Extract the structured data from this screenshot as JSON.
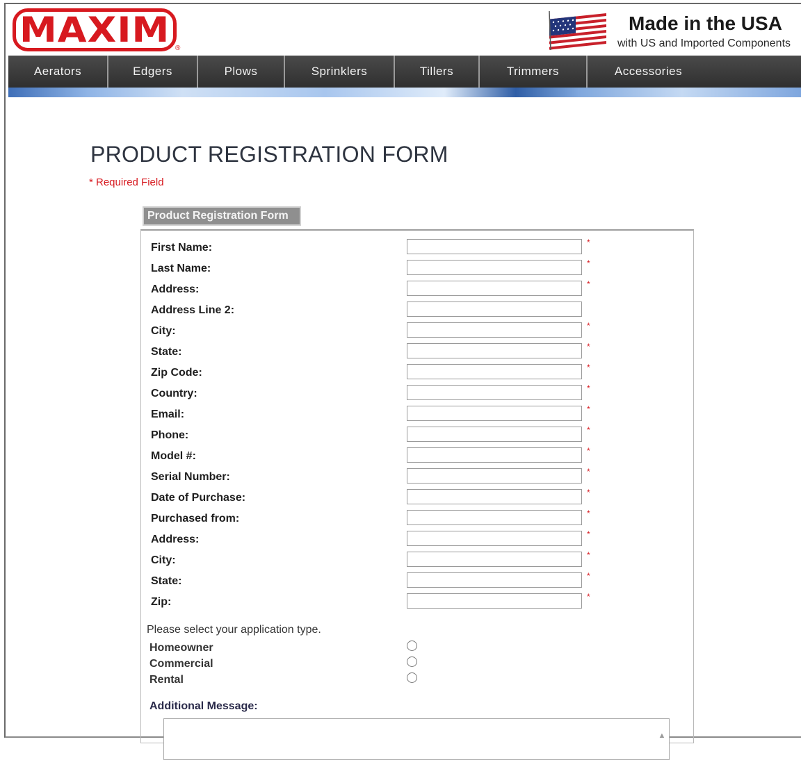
{
  "header": {
    "logo_text": "MAXIM",
    "logo_mark": "®",
    "flag_icon": "us-flag-icon",
    "made_title": "Made in the USA",
    "made_subtitle": "with US and Imported Components"
  },
  "nav": {
    "items": [
      {
        "label": "Aerators"
      },
      {
        "label": "Edgers"
      },
      {
        "label": "Plows"
      },
      {
        "label": "Sprinklers"
      },
      {
        "label": "Tillers"
      },
      {
        "label": "Trimmers"
      },
      {
        "label": "Accessories"
      }
    ]
  },
  "page": {
    "title": "PRODUCT REGISTRATION FORM",
    "required_note": "* Required Field"
  },
  "form": {
    "tab_label": "Product Registration Form",
    "required_marker": "*",
    "fields": [
      {
        "label": "First Name:",
        "value": "",
        "required": true
      },
      {
        "label": "Last Name:",
        "value": "",
        "required": true
      },
      {
        "label": "Address:",
        "value": "",
        "required": true
      },
      {
        "label": "Address Line 2:",
        "value": "",
        "required": false
      },
      {
        "label": "City:",
        "value": "",
        "required": true
      },
      {
        "label": "State:",
        "value": "",
        "required": true
      },
      {
        "label": "Zip Code:",
        "value": "",
        "required": true
      },
      {
        "label": "Country:",
        "value": "",
        "required": true
      },
      {
        "label": "Email:",
        "value": "",
        "required": true
      },
      {
        "label": "Phone:",
        "value": "",
        "required": true
      },
      {
        "label": "Model #:",
        "value": "",
        "required": true
      },
      {
        "label": "Serial Number:",
        "value": "",
        "required": true
      },
      {
        "label": "Date of Purchase:",
        "value": "",
        "required": true
      },
      {
        "label": "Purchased from:",
        "value": "",
        "required": true
      },
      {
        "label": "Address:",
        "value": "",
        "required": true
      },
      {
        "label": "City:",
        "value": "",
        "required": true
      },
      {
        "label": "State:",
        "value": "",
        "required": true
      },
      {
        "label": "Zip:",
        "value": "",
        "required": true
      }
    ],
    "application_prompt": "Please select your application type.",
    "application_types": [
      {
        "label": "Homeowner",
        "selected": false
      },
      {
        "label": "Commercial",
        "selected": false
      },
      {
        "label": "Rental",
        "selected": false
      }
    ],
    "message_label": "Additional Message:",
    "message_value": ""
  },
  "colors": {
    "brand_red": "#d7191f",
    "nav_bg": "#3a3a3a",
    "tab_bg": "#8f8f8f"
  }
}
